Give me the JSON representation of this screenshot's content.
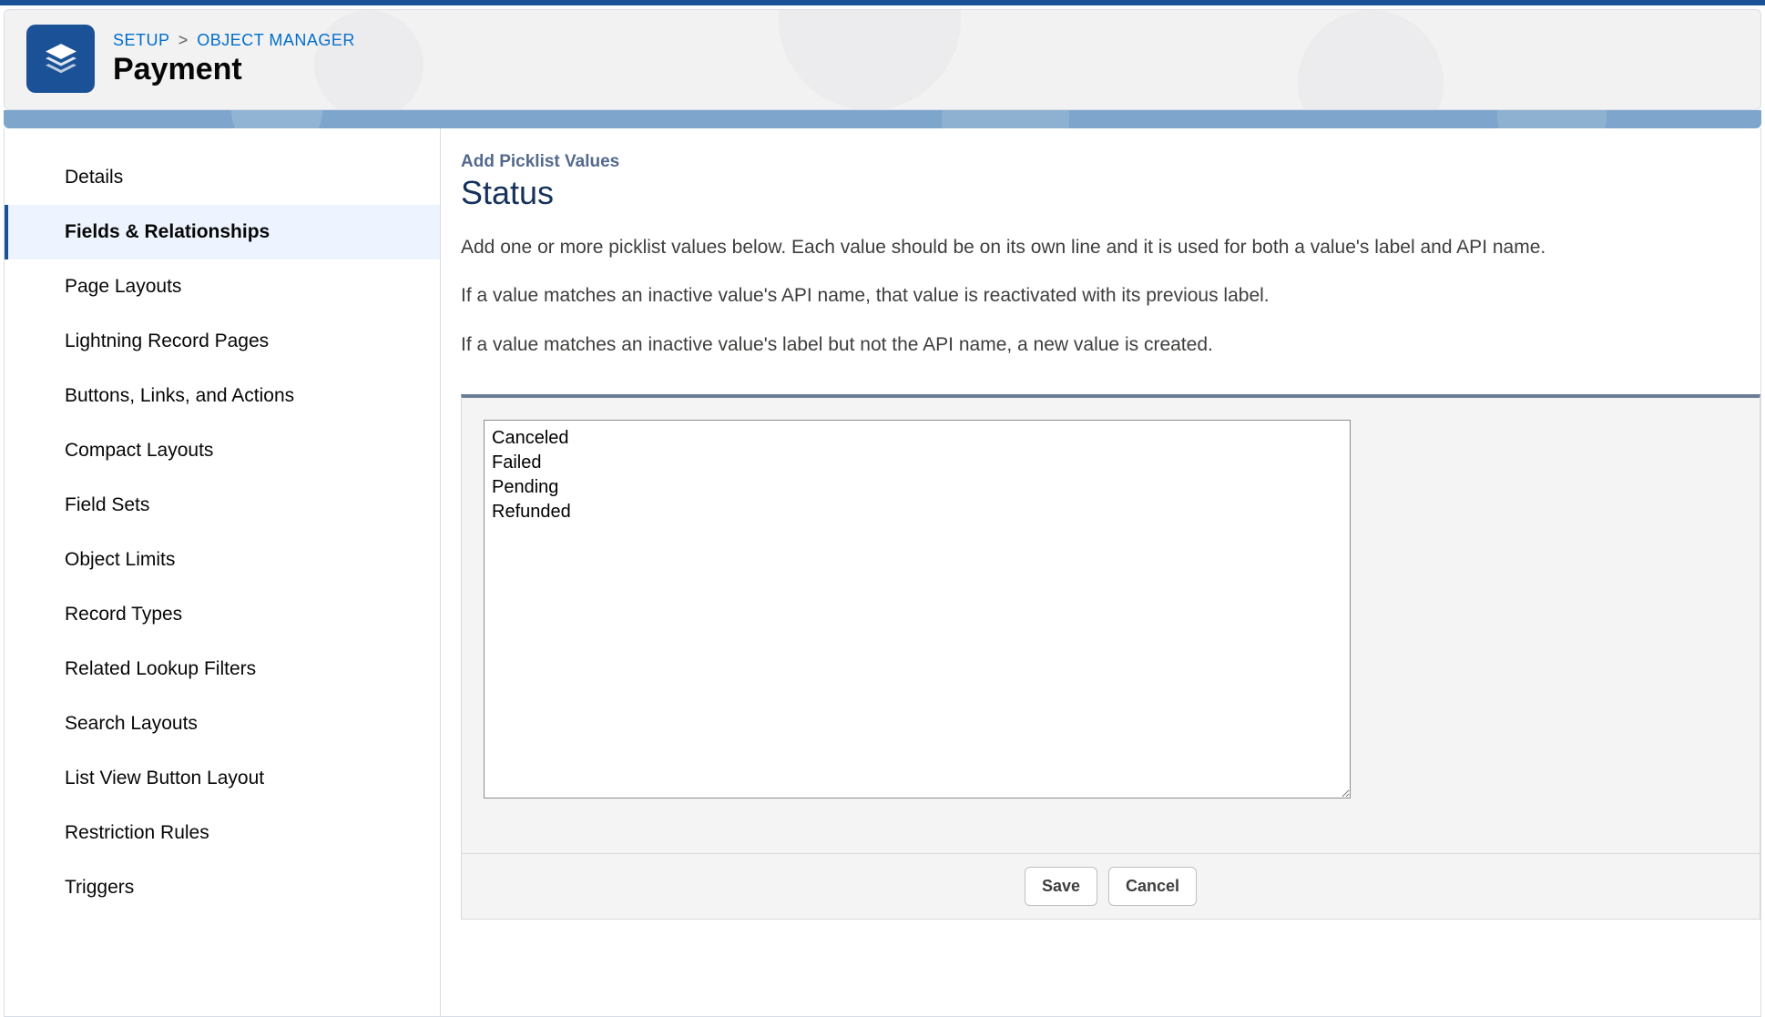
{
  "breadcrumb": {
    "setup": "SETUP",
    "separator": ">",
    "object_manager": "OBJECT MANAGER"
  },
  "page_title": "Payment",
  "sidebar": {
    "items": [
      {
        "label": "Details",
        "active": false
      },
      {
        "label": "Fields & Relationships",
        "active": true
      },
      {
        "label": "Page Layouts",
        "active": false
      },
      {
        "label": "Lightning Record Pages",
        "active": false
      },
      {
        "label": "Buttons, Links, and Actions",
        "active": false
      },
      {
        "label": "Compact Layouts",
        "active": false
      },
      {
        "label": "Field Sets",
        "active": false
      },
      {
        "label": "Object Limits",
        "active": false
      },
      {
        "label": "Record Types",
        "active": false
      },
      {
        "label": "Related Lookup Filters",
        "active": false
      },
      {
        "label": "Search Layouts",
        "active": false
      },
      {
        "label": "List View Button Layout",
        "active": false
      },
      {
        "label": "Restriction Rules",
        "active": false
      },
      {
        "label": "Triggers",
        "active": false
      }
    ]
  },
  "main": {
    "subhead": "Add Picklist Values",
    "field_title": "Status",
    "help1": "Add one or more picklist values below. Each value should be on its own line and it is used for both a value's label and API name.",
    "help2": "If a value matches an inactive value's API name, that value is reactivated with its previous label.",
    "help3": "If a value matches an inactive value's label but not the API name, a new value is created.",
    "textarea_value": "Canceled\nFailed\nPending\nRefunded",
    "buttons": {
      "save": "Save",
      "cancel": "Cancel"
    }
  }
}
